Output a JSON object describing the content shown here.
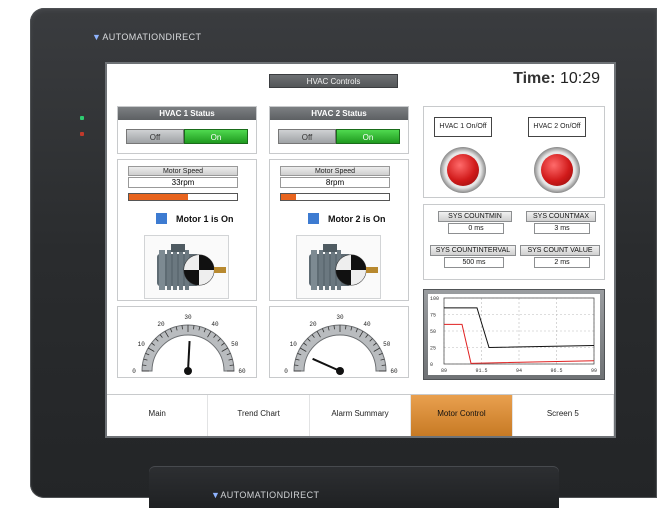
{
  "device": {
    "brand_top": "AUTOMATIONDIRECT",
    "brand_bottom": "AUTOMATIONDIRECT",
    "brand_mark": "▼"
  },
  "header": {
    "title": "HVAC Controls",
    "time_label": "Time:",
    "time_value": "10:29"
  },
  "hvac1": {
    "title": "HVAC 1 Status",
    "off_label": "Off",
    "on_label": "On",
    "speed_label": "Motor Speed",
    "speed_value": "33rpm",
    "speed_fraction": 0.55,
    "status_text": "Motor 1 is On",
    "gauge_value": 31
  },
  "hvac2": {
    "title": "HVAC 2 Status",
    "off_label": "Off",
    "on_label": "On",
    "speed_label": "Motor Speed",
    "speed_value": "8rpm",
    "speed_fraction": 0.14,
    "status_text": "Motor 2 is On",
    "gauge_value": 8
  },
  "gauge_ticks": [
    "0",
    "10",
    "20",
    "30",
    "40",
    "50",
    "60"
  ],
  "onoff": {
    "hvac1_label": "HVAC 1 On/Off",
    "hvac2_label": "HVAC 2 On/Off"
  },
  "sys": {
    "countmin_label": "SYS COUNTMIN",
    "countmin_value": "0 ms",
    "countmax_label": "SYS COUNTMAX",
    "countmax_value": "3 ms",
    "countinterval_label": "SYS COUNTINTERVAL",
    "countinterval_value": "500 ms",
    "countvalue_label": "SYS COUNT VALUE",
    "countvalue_value": "2 ms"
  },
  "trend": {
    "y_ticks": [
      "100",
      "75",
      "50",
      "25",
      "0"
    ],
    "x_ticks": [
      "89",
      "91.5",
      "94",
      "96.5",
      "99"
    ],
    "xlim": [
      89,
      99
    ],
    "ylim": [
      0,
      100
    ],
    "series": [
      {
        "color": "#111111",
        "x": [
          89,
          90.5,
          91.2,
          92,
          99
        ],
        "y": [
          85,
          85,
          85,
          25,
          28
        ]
      },
      {
        "color": "#e02020",
        "x": [
          89,
          89.6,
          90.2,
          90.8,
          99
        ],
        "y": [
          60,
          60,
          60,
          1,
          5
        ]
      }
    ]
  },
  "tabs": [
    {
      "label": "Main"
    },
    {
      "label": "Trend Chart"
    },
    {
      "label": "Alarm Summary"
    },
    {
      "label": "Motor Control"
    },
    {
      "label": "Screen 5"
    }
  ],
  "active_tab": 3
}
